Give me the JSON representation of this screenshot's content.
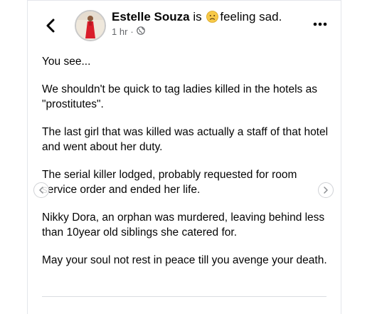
{
  "post": {
    "author": "Estelle Souza",
    "status_prefix": "is",
    "feeling": "feeling sad.",
    "time": "1 hr",
    "separator": "·",
    "privacy_icon": "globe-icon",
    "paragraphs": [
      "You see...",
      "We shouldn't be quick to tag ladies killed in the hotels as \"prostitutes\".",
      "The last girl that was killed was actually a staff of that hotel and went about her duty.",
      "The serial killer lodged, probably requested for room service order and ended her life.",
      "Nikky Dora, an orphan was murdered, leaving behind less than 10year old siblings she catered for.",
      "May your soul not rest in peace till you avenge your death."
    ]
  },
  "icons": {
    "back": "chevron-left-icon",
    "more": "more-dots-icon",
    "emoji": "sad-face-icon",
    "prev": "chevron-left-icon",
    "next": "chevron-right-icon"
  },
  "colors": {
    "text": "#050505",
    "meta": "#65676b",
    "emoji": "#f7c948"
  }
}
